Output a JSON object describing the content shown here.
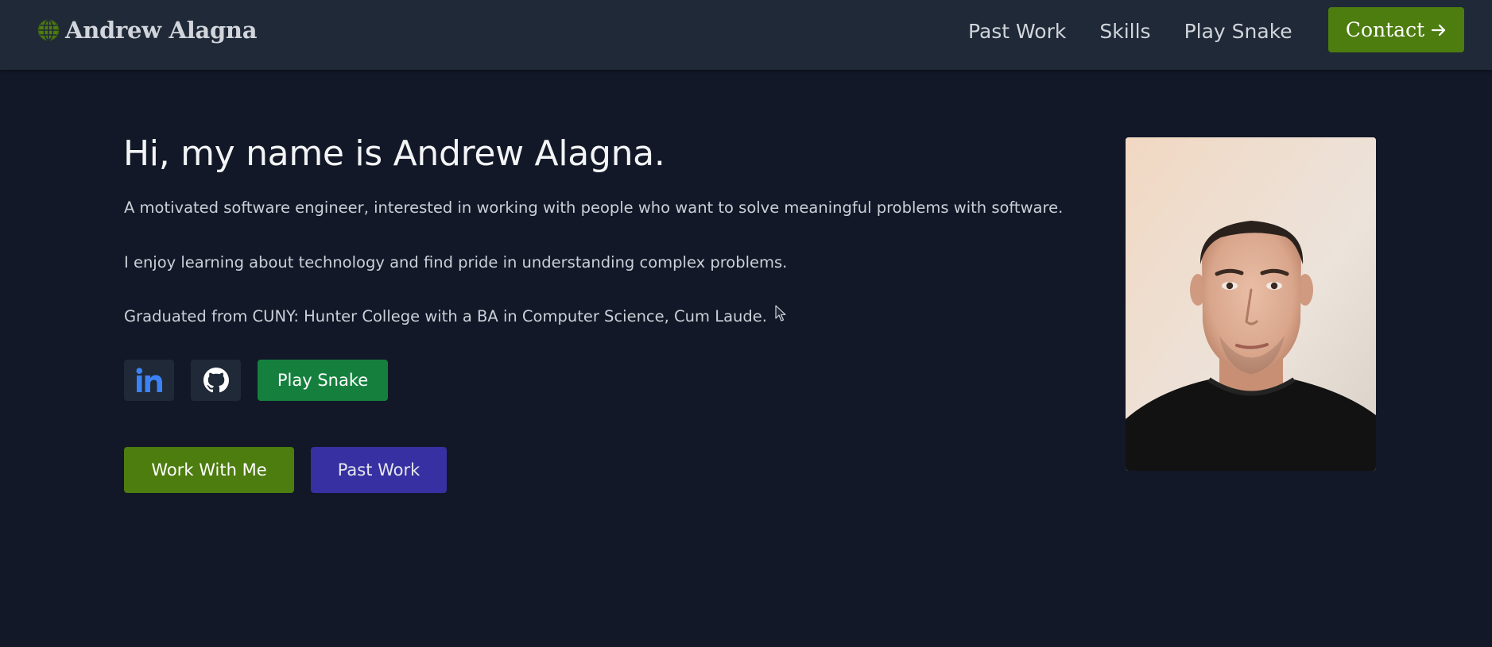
{
  "header": {
    "brand_name": "Andrew Alagna",
    "brand_icon": "globe-icon",
    "nav_links": [
      "Past Work",
      "Skills",
      "Play Snake"
    ],
    "contact_label": "Contact",
    "contact_icon": "arrow-right-icon"
  },
  "hero": {
    "title": "Hi, my name is Andrew Alagna.",
    "paragraphs": [
      "A motivated software engineer, interested in working with people who want to solve meaningful problems with software.",
      "I enjoy learning about technology and find pride in understanding complex problems.",
      "Graduated from CUNY: Hunter College with a BA in Computer Science, Cum Laude."
    ],
    "social": {
      "linkedin_icon": "linkedin-icon",
      "github_icon": "github-icon",
      "snake_label": "Play Snake"
    },
    "cta": {
      "work_with_me": "Work With Me",
      "past_work": "Past Work"
    }
  },
  "colors": {
    "background": "#121827",
    "navbar": "#1f2937",
    "olive_green": "#4d7c0f",
    "green": "#15803d",
    "indigo": "#3730a3",
    "linkedin_blue": "#3b82f6"
  }
}
